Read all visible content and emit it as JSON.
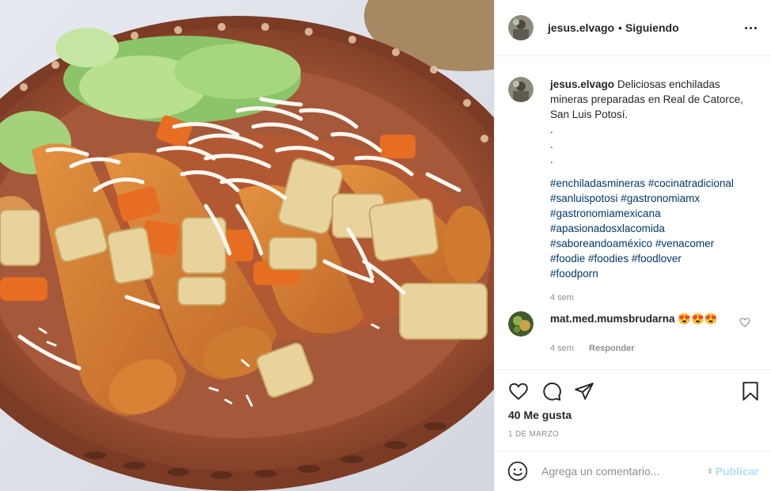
{
  "post": {
    "username": "jesus.elvago",
    "separator": "•",
    "follow_status": "Siguiendo",
    "more_icon": "more-options-icon"
  },
  "caption": {
    "username": "jesus.elvago",
    "text": "Deliciosas enchiladas mineras preparadas en Real de Catorce, San Luis Potosí.",
    "dots": [
      ".",
      ".",
      "."
    ],
    "hashtags": [
      "#enchiladasmineras #cocinatradicional",
      "#sanluispotosi #gastronomiamx",
      "#gastronomiamexicana",
      "#apasionadosxlacomida",
      "#saboreandoaméxico #venacomer",
      "#foodie #foodies #foodlover",
      "#foodporn"
    ],
    "time": "4 sem"
  },
  "comment": {
    "username": "mat.med.mumsbrudarna",
    "text": "😍😍😍",
    "time": "4 sem",
    "reply_label": "Responder"
  },
  "actions": {
    "icons": [
      "heart-icon",
      "comment-icon",
      "share-icon",
      "bookmark-icon"
    ],
    "likes": "40 Me gusta",
    "date": "1 DE MARZO"
  },
  "composer": {
    "placeholder": "Agrega un comentario...",
    "publish_label": "Publicar"
  },
  "colors": {
    "hashtag": "#00376b",
    "secondary_text": "#8e8e8e",
    "publish_disabled": "#b2dffc",
    "plate": "#a85a3c",
    "border": "#efefef"
  }
}
